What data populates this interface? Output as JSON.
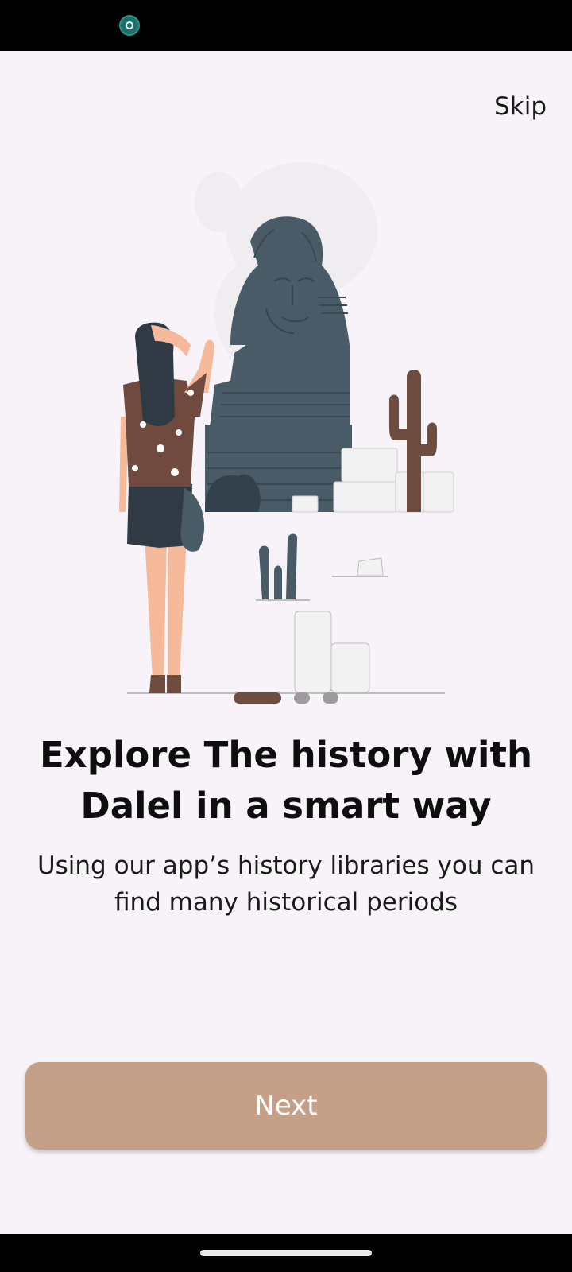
{
  "status_bar": {
    "icon": "app-notification-icon"
  },
  "header": {
    "skip_label": "Skip"
  },
  "illustration": {
    "description_icon": "traveler-sphinx-illustration",
    "colors": {
      "stone": "#4a5b68",
      "skin": "#f6b99a",
      "shirt": "#704a3f",
      "cactus": "#6f4c40"
    }
  },
  "pager": {
    "total": 3,
    "active_index": 0,
    "active_color": "#6f4c40",
    "inactive_color": "#9e9a9f"
  },
  "content": {
    "title": "Explore The history with Dalel in a smart way",
    "subtitle": "Using our app’s history libraries you can find many historical periods"
  },
  "actions": {
    "next_label": "Next",
    "button_color": "#c4a088"
  },
  "system_nav": {
    "home_indicator": "home-gesture-bar"
  }
}
